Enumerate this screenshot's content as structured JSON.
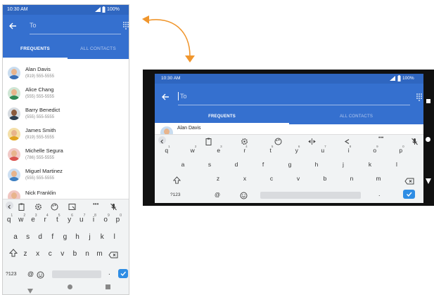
{
  "status": {
    "time": "10:30 AM",
    "battery": "100%"
  },
  "search": {
    "placeholder": "To"
  },
  "tabs": {
    "frequents": "FREQUENTS",
    "all_contacts": "ALL CONTACTS"
  },
  "contacts": [
    {
      "name": "Alan Davis",
      "phone": "(919) 555-5555",
      "color": "#3b6fb5"
    },
    {
      "name": "Alice Chang",
      "phone": "(555) 555-5555",
      "color": "#2f8a55"
    },
    {
      "name": "Barry Benedict",
      "phone": "(555) 555-5555",
      "color": "#2c3e50"
    },
    {
      "name": "James Smith",
      "phone": "(919) 555-5555",
      "color": "#e0a420"
    },
    {
      "name": "Michelle Segura",
      "phone": "(786) 555-5555",
      "color": "#d9534f"
    },
    {
      "name": "Miguel Martinez",
      "phone": "(555) 555-5555",
      "color": "#3d7fc1"
    },
    {
      "name": "Nick Franklin",
      "phone": "",
      "color": "#c0392b"
    }
  ],
  "keyboard": {
    "row1": [
      "q",
      "w",
      "e",
      "r",
      "t",
      "y",
      "u",
      "i",
      "o",
      "p"
    ],
    "row1_hints": [
      "1",
      "2",
      "3",
      "4",
      "5",
      "6",
      "7",
      "8",
      "9",
      "0"
    ],
    "row2": [
      "a",
      "s",
      "d",
      "f",
      "g",
      "h",
      "j",
      "k",
      "l"
    ],
    "row3": [
      "z",
      "x",
      "c",
      "v",
      "b",
      "n",
      "m"
    ],
    "symbols_key": "?123",
    "at_key": "@",
    "period_key": ".",
    "more_key": "•••"
  },
  "colors": {
    "app_bar": "#3570cf",
    "status_bar": "#2f66c0",
    "keyboard_bg": "#f1f3f4",
    "accent_arrow": "#f0962d",
    "enter_key": "#2f8de4"
  }
}
